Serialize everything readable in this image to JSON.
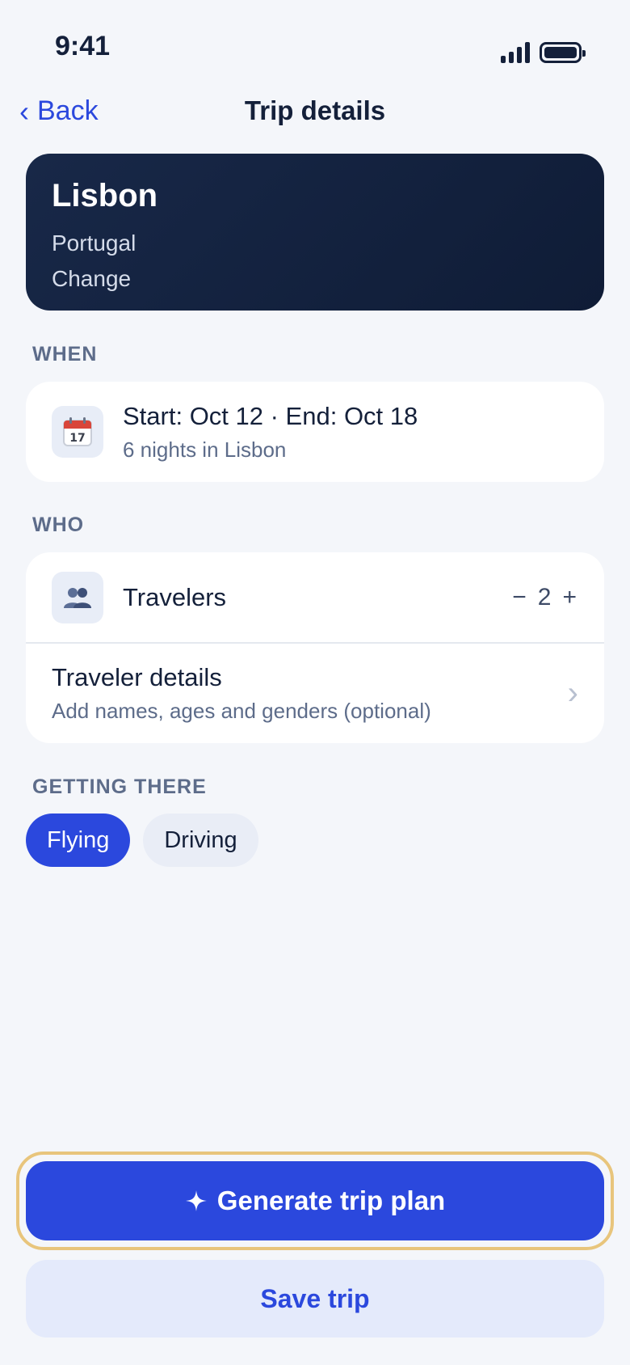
{
  "status_bar": {
    "time": "9:41"
  },
  "nav": {
    "back_label": "Back",
    "title": "Trip details"
  },
  "destination": {
    "city": "Lisbon",
    "country": "Portugal",
    "change_label": "Change"
  },
  "when": {
    "section_label": "WHEN",
    "dates": "Start: Oct 12 · End: Oct 18",
    "nights": "6 nights in Lisbon",
    "icon": "calendar-icon"
  },
  "who": {
    "section_label": "WHO",
    "travelers_label": "Travelers",
    "travelers_count": "2",
    "minus": "−",
    "plus": "+",
    "icon": "people-icon",
    "details_title": "Traveler details",
    "details_sub": "Add names, ages and genders (optional)"
  },
  "getting_there": {
    "section_label": "GETTING THERE",
    "options": [
      "Flying",
      "Driving"
    ],
    "selected": "Flying"
  },
  "actions": {
    "generate_label": "Generate trip plan",
    "generate_icon": "sparkle-icon",
    "save_label": "Save trip"
  },
  "colors": {
    "accent": "#2b48dd",
    "card_dark": "#14203a",
    "highlight_outline": "#e8c57c"
  }
}
